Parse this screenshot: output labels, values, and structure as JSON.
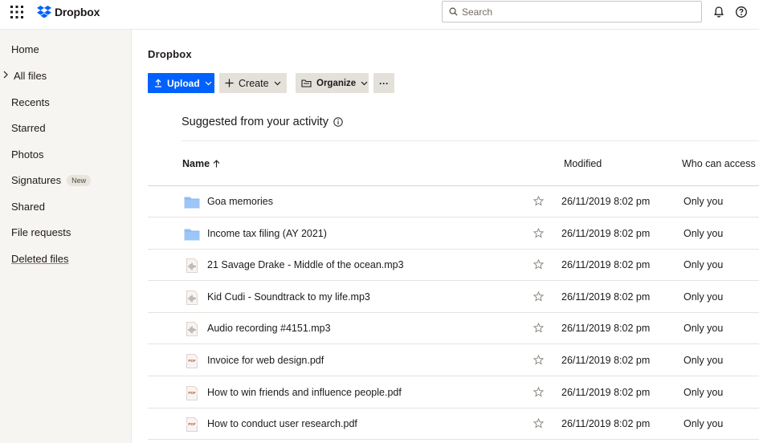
{
  "topbar": {
    "brand": "Dropbox",
    "search_placeholder": "Search"
  },
  "sidebar": {
    "items": [
      {
        "label": "Home"
      },
      {
        "label": "All files"
      },
      {
        "label": "Recents"
      },
      {
        "label": "Starred"
      },
      {
        "label": "Photos"
      },
      {
        "label": "Signatures",
        "badge": "New"
      },
      {
        "label": "Shared"
      },
      {
        "label": "File requests"
      },
      {
        "label": "Deleted files"
      }
    ]
  },
  "main": {
    "breadcrumb": "Dropbox",
    "toolbar": {
      "upload_label": "Upload",
      "create_label": "Create",
      "organize_label": "Organize",
      "more_label": "···"
    },
    "suggested_title": "Suggested from your activity",
    "columns": {
      "name": "Name",
      "modified": "Modified",
      "access": "Who can access"
    },
    "files": [
      {
        "name": "Goa memories",
        "type": "folder",
        "modified": "26/11/2019 8:02 pm",
        "access": "Only you"
      },
      {
        "name": "Income tax filing (AY 2021)",
        "type": "folder",
        "modified": "26/11/2019 8:02 pm",
        "access": "Only you"
      },
      {
        "name": "21 Savage Drake - Middle of the ocean.mp3",
        "type": "audio",
        "modified": "26/11/2019 8:02 pm",
        "access": "Only you"
      },
      {
        "name": "Kid Cudi - Soundtrack to my life.mp3",
        "type": "audio",
        "modified": "26/11/2019 8:02 pm",
        "access": "Only you"
      },
      {
        "name": "Audio recording #4151.mp3",
        "type": "audio",
        "modified": "26/11/2019 8:02 pm",
        "access": "Only you"
      },
      {
        "name": "Invoice for web design.pdf",
        "type": "pdf",
        "modified": "26/11/2019 8:02 pm",
        "access": "Only you"
      },
      {
        "name": "How to win friends and influence people.pdf",
        "type": "pdf",
        "modified": "26/11/2019 8:02 pm",
        "access": "Only you"
      },
      {
        "name": "How to conduct user research.pdf",
        "type": "pdf",
        "modified": "26/11/2019 8:02 pm",
        "access": "Only you"
      }
    ]
  },
  "colors": {
    "accent": "#0061fe",
    "folder": "#8fbcf2",
    "sidebar_bg": "#f7f5f2",
    "pdf_red": "#e24a2c"
  }
}
